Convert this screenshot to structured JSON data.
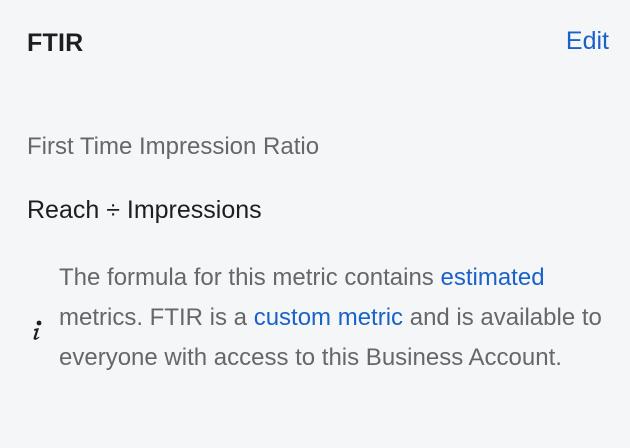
{
  "header": {
    "title": "FTIR",
    "edit_label": "Edit"
  },
  "metric": {
    "full_name": "First Time Impression Ratio",
    "formula": "Reach ÷ Impressions"
  },
  "note": {
    "text_1": "The formula for this metric contains",
    "link_estimated": "estimated",
    "text_2": "metrics. FTIR is a",
    "link_custom_metric": "custom metric",
    "text_3": "and is available to everyone with access to this Business Account."
  },
  "colors": {
    "link": "#1a62c9",
    "title": "#1c1e21",
    "muted": "#65676b",
    "background": "#f5f6f7"
  },
  "icons": {
    "info": "info-italic-i-icon"
  }
}
